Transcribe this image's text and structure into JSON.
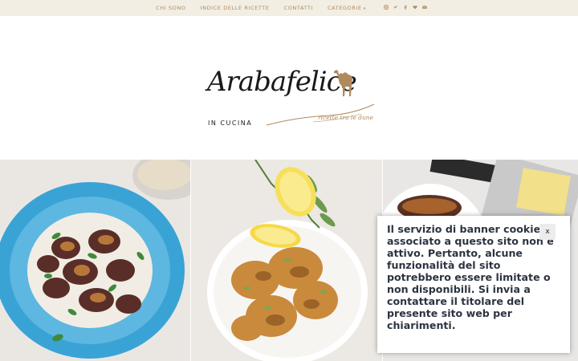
{
  "nav": {
    "items": [
      "CHI SONO",
      "INDICE DELLE RICETTE",
      "CONTATTI",
      "CATEGORIE"
    ],
    "categories_caret": "▾",
    "social": [
      {
        "icon": "instagram-icon",
        "glyph": "◎"
      },
      {
        "icon": "twitter-icon",
        "glyph": "♥"
      },
      {
        "icon": "facebook-icon",
        "glyph": "f"
      },
      {
        "icon": "heart-icon",
        "glyph": "♥"
      },
      {
        "icon": "mail-icon",
        "glyph": "✉"
      }
    ]
  },
  "logo": {
    "brand": "Arabafelice",
    "subtitle": "IN CUCINA",
    "tagline": "ricette tra le dune"
  },
  "cookie_banner": {
    "text": "Il servizio di banner cookie associato a questo sito non è attivo. Pertanto, alcune funzionalità del sito potrebbero essere limitate o non disponibili. Si invia a contattare il titolare del presente sito web per chiarimenti.",
    "close_label": "x"
  },
  "colors": {
    "nav_bg": "#f3eee3",
    "accent": "#b08a5e",
    "banner_text": "#2b3441"
  }
}
